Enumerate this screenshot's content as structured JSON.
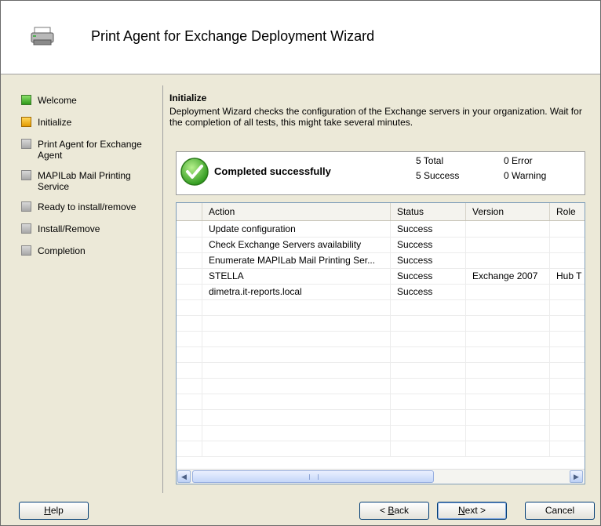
{
  "header": {
    "title": "Print Agent for Exchange Deployment Wizard",
    "icon": "printer-icon"
  },
  "steps": [
    {
      "label": "Welcome",
      "state": "done"
    },
    {
      "label": "Initialize",
      "state": "active"
    },
    {
      "label": "Print Agent for Exchange Agent",
      "state": "pending"
    },
    {
      "label": "MAPILab Mail Printing Service",
      "state": "pending"
    },
    {
      "label": "Ready to install/remove",
      "state": "pending"
    },
    {
      "label": "Install/Remove",
      "state": "pending"
    },
    {
      "label": "Completion",
      "state": "pending"
    }
  ],
  "content": {
    "title": "Initialize",
    "description": "Deployment Wizard checks the configuration of the Exchange servers in your organization. Wait for the completion of all tests, this might take several minutes."
  },
  "status": {
    "text": "Completed successfully",
    "total_label": "5  Total",
    "success_label": "5  Success",
    "error_label": "0  Error",
    "warning_label": "0  Warning"
  },
  "table": {
    "columns": [
      "Action",
      "Status",
      "Version",
      "Role"
    ],
    "rows": [
      [
        "Update configuration",
        "Success",
        "",
        ""
      ],
      [
        "Check Exchange Servers availability",
        "Success",
        "",
        ""
      ],
      [
        "Enumerate MAPILab Mail Printing Ser...",
        "Success",
        "",
        ""
      ],
      [
        "STELLA",
        "Success",
        "Exchange 2007",
        "Hub T"
      ],
      [
        "dimetra.it-reports.local",
        "Success",
        "",
        ""
      ]
    ]
  },
  "buttons": {
    "help_hot": "H",
    "help_rest": "elp",
    "back_pre": "< ",
    "back_hot": "B",
    "back_rest": "ack",
    "next_hot": "N",
    "next_rest": "ext >",
    "cancel": "Cancel"
  },
  "colors": {
    "accent": "#003c74",
    "success": "#2e9a1a",
    "active": "#e39a00"
  }
}
